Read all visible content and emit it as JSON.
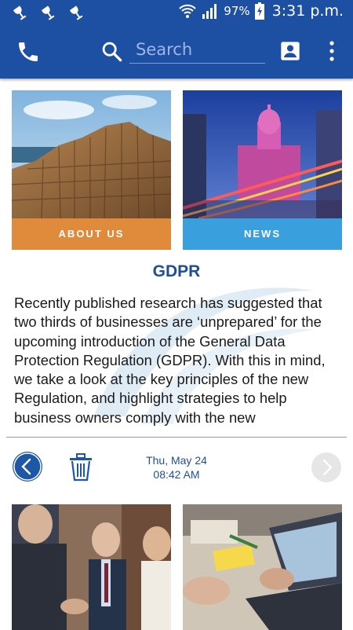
{
  "status_bar": {
    "notification_icons": [
      "bell-icon",
      "bell-icon",
      "bell-icon"
    ],
    "battery": "97%",
    "time": "3:31 p.m."
  },
  "app_bar": {
    "search_placeholder": "Search",
    "icons": [
      "phone-icon",
      "search-icon",
      "contact-icon",
      "overflow-menu-icon"
    ],
    "color": "#1d4fa3"
  },
  "tiles": [
    {
      "label": "ABOUT US",
      "color": "#e08a3c"
    },
    {
      "label": "NEWS",
      "color": "#3aa0dd"
    }
  ],
  "article": {
    "title": "GDPR",
    "body": "Recently published research has suggested that two thirds of businesses are ‘unprepared’ for the upcoming introduction of the General Data Protection Regulation (GDPR). With this in mind, we take a look at the key principles of the new Regulation, and highlight strategies to help business owners comply with the new"
  },
  "navigation": {
    "date": "Thu, May 24",
    "time": "08:42 AM"
  }
}
